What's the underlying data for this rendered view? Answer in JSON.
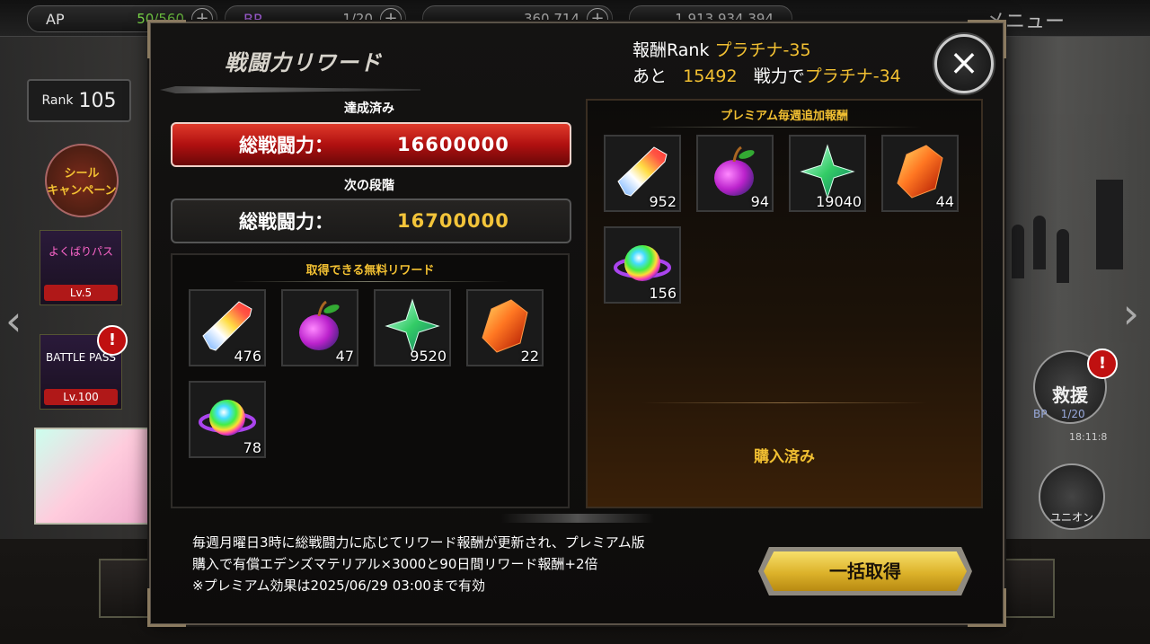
{
  "topbar": {
    "ap": {
      "label": "AP",
      "value": "50/560"
    },
    "bp": {
      "label": "BP",
      "value": "1/20"
    },
    "res1": {
      "value": "360,714"
    },
    "res2": {
      "value": "1,913,934,394"
    },
    "plus": "+",
    "menu": "メニュー",
    "alert": "!"
  },
  "sidebar": {
    "rank_label": "Rank",
    "rank_value": "105",
    "seal": "シール\nキャンペーン",
    "yokubari": "よくばりパス",
    "yokubari_lv": "Lv.5",
    "battlepass": "BATTLE PASS",
    "battlepass_lv": "Lv.100"
  },
  "right_side": {
    "rescue": "救援",
    "bp": "BP",
    "bp_val": "1/20",
    "time": "18:11:8",
    "union": "ユニオン"
  },
  "modal": {
    "title": "戦闘力リワード",
    "reward_rank_label": "報酬Rank",
    "reward_rank_value": "プラチナ-35",
    "remain_prefix": "あと",
    "remain_value": "15492",
    "remain_mid": "戦力で",
    "remain_target": "プラチナ-34",
    "close": "×",
    "achieved_label": "達成済み",
    "achieved_key": "総戦闘力：",
    "achieved_value": "16600000",
    "next_label": "次の段階",
    "next_key": "総戦闘力：",
    "next_value": "16700000",
    "free_head": "取得できる無料リワード",
    "free_items": [
      {
        "icon": "rainbow-crystal-icon",
        "qty": "476"
      },
      {
        "icon": "purple-apple-icon",
        "qty": "47"
      },
      {
        "icon": "green-star-gem-icon",
        "qty": "9520"
      },
      {
        "icon": "red-orange-stone-icon",
        "qty": "22"
      },
      {
        "icon": "rainbow-orb-icon",
        "qty": "78"
      }
    ],
    "prem_head": "プレミアム毎週追加報酬",
    "prem_items": [
      {
        "icon": "rainbow-crystal-icon",
        "qty": "952"
      },
      {
        "icon": "purple-apple-icon",
        "qty": "94"
      },
      {
        "icon": "green-star-gem-icon",
        "qty": "19040"
      },
      {
        "icon": "red-orange-stone-icon",
        "qty": "44"
      },
      {
        "icon": "rainbow-orb-icon",
        "qty": "156"
      }
    ],
    "purchased": "購入済み",
    "note1": "毎週月曜日3時に総戦闘力に応じてリワード報酬が更新され、プレミアム版",
    "note2": "購入で有償エデンズマテリアル×3000と90日間リワード報酬+2倍",
    "note3": "※プレミアム効果は2025/06/29 03:00まで有効",
    "claim_all": "一括取得"
  },
  "colors": {
    "gold": "#f2c032",
    "achieved_red": "#c01818",
    "panel_bg": "#0c0b0a"
  }
}
